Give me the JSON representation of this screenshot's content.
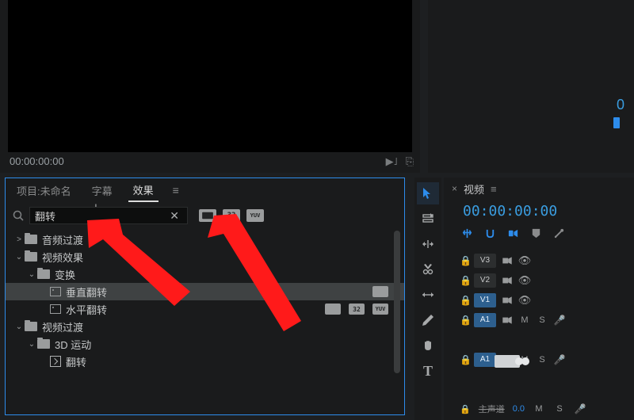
{
  "monitor": {
    "timecode": "00:00:00:00"
  },
  "right_preview": {
    "value": "0"
  },
  "effects_panel": {
    "tabs": {
      "project": "项目:未命名",
      "subtitles": "字幕",
      "effects": "效果"
    },
    "search": {
      "value": "翻转",
      "badges": {
        "fx": "",
        "thirtytwo": "32",
        "yuv": "YUV"
      }
    },
    "tree": [
      {
        "label": "音频过渡",
        "type": "folder",
        "level": 1,
        "arrow": ">"
      },
      {
        "label": "视频效果",
        "type": "folder",
        "level": 1,
        "arrow": "v"
      },
      {
        "label": "变换",
        "type": "folder",
        "level": 2,
        "arrow": "v"
      },
      {
        "label": "垂直翻转",
        "type": "preset",
        "level": 3,
        "selected": true,
        "badges": [
          "fx"
        ]
      },
      {
        "label": "水平翻转",
        "type": "preset",
        "level": 3,
        "badges": [
          "fx",
          "32",
          "yuv"
        ]
      },
      {
        "label": "视频过渡",
        "type": "folder",
        "level": 1,
        "arrow": "v"
      },
      {
        "label": "3D 运动",
        "type": "folder",
        "level": 2,
        "arrow": "v"
      },
      {
        "label": "翻转",
        "type": "preset2",
        "level": 3
      }
    ]
  },
  "timeline": {
    "tab": "视频",
    "timecode": "00:00:00:00",
    "tracks": {
      "v3": "V3",
      "v2": "V2",
      "v1": "V1",
      "a1": "A1",
      "m": "M",
      "s": "S"
    },
    "bottom": {
      "label": "主声道",
      "value": "0.0"
    }
  }
}
